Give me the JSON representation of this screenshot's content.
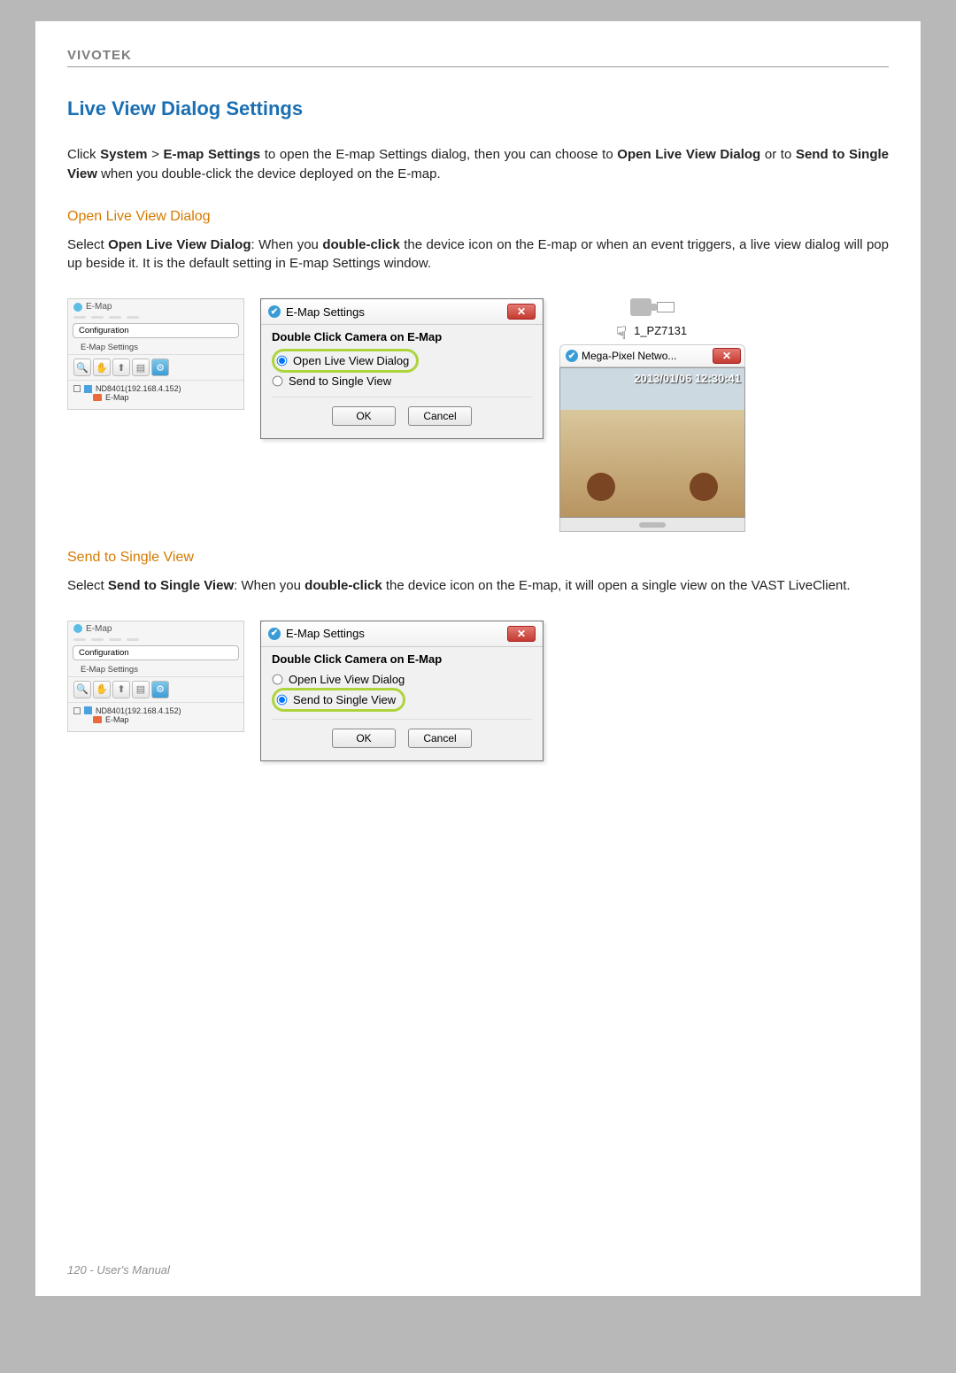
{
  "brand": "VIVOTEK",
  "page_title": "Live View Dialog Settings",
  "intro": {
    "pre": "Click ",
    "b1": "System",
    "gt": " > ",
    "b2": "E-map Settings",
    "mid": " to open the E-map Settings dialog, then you can choose to ",
    "b3": "Open Live View Dialog",
    "or": " or to ",
    "b4": "Send to Single View",
    "post": " when you double-click the device deployed on the E-map."
  },
  "sec1_title": "Open Live View Dialog",
  "sec1_text": {
    "pre": "Select ",
    "b1": "Open Live View Dialog",
    "mid1": ": When you ",
    "b2": "double-click",
    "post": " the device icon on the E-map or when an event triggers, a live view dialog will pop up beside it. It is the default setting in E-map Settings window."
  },
  "sec2_title": "Send to Single View",
  "sec2_text": {
    "pre": "Select ",
    "b1": "Send to Single View",
    "mid1": ": When you ",
    "b2": "double-click",
    "post": " the device icon on the E-map, it will open a single view on the VAST LiveClient."
  },
  "sidepanel": {
    "title": "E-Map",
    "config": "Configuration",
    "settings": "E-Map Settings",
    "tree_device": "ND8401(192.168.4.152)",
    "tree_emap": "E-Map"
  },
  "dialog": {
    "title": "E-Map Settings",
    "heading": "Double Click Camera on E-Map",
    "opt1": "Open Live View Dialog",
    "opt2": "Send to Single View",
    "ok": "OK",
    "cancel": "Cancel"
  },
  "preview": {
    "cam_label": "1_PZ7131",
    "mini_title": "Mega-Pixel Netwo...",
    "timestamp": "2013/01/06 12:30:41"
  },
  "footer_page": "120 - User's Manual"
}
